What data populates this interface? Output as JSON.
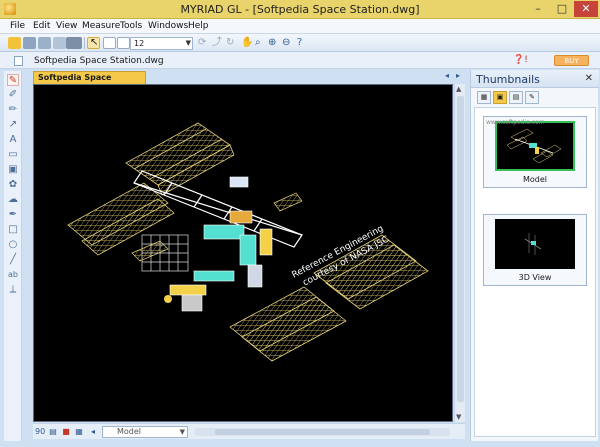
{
  "window": {
    "title": "MYRIAD GL - [Softpedia Space Station.dwg]",
    "minimize": "–",
    "maximize": "□",
    "close": "✕"
  },
  "menu": [
    "File",
    "Edit",
    "View",
    "Measure",
    "Tools",
    "Windows",
    "Help"
  ],
  "toolbar": {
    "zoom_value": "12",
    "icons": [
      "open-folder-icon",
      "print-icon",
      "print-preview-icon",
      "layout-icon",
      "select-arrow-icon",
      "page-icon",
      "page-copy-icon",
      "pan-hand-icon",
      "zoom-window-icon",
      "zoom-in-icon",
      "zoom-out-icon",
      "help-icon"
    ]
  },
  "document": {
    "file_name": "Softpedia Space Station.dwg",
    "buy_label": "BUY"
  },
  "drawing": {
    "tab_label": "Softpedia Space Station.dwg",
    "canvas_text": [
      "Reference Engineering",
      "courtesy of NASA JSC"
    ]
  },
  "bottom": {
    "layout_value": "Model"
  },
  "thumbnails": {
    "title": "Thumbnails",
    "close": "✕",
    "items": [
      {
        "label": "Model",
        "selected": true,
        "watermark": "www.softpedia.com"
      },
      {
        "label": "3D View",
        "selected": false,
        "watermark": ""
      }
    ]
  },
  "colors": {
    "titlebar": "#e8d46a",
    "tab_active": "#f4c94a",
    "canvas_bg": "#000000",
    "solar_panel": "#d8c46a",
    "truss": "#ffffff",
    "module_cyan": "#53e0d0"
  }
}
